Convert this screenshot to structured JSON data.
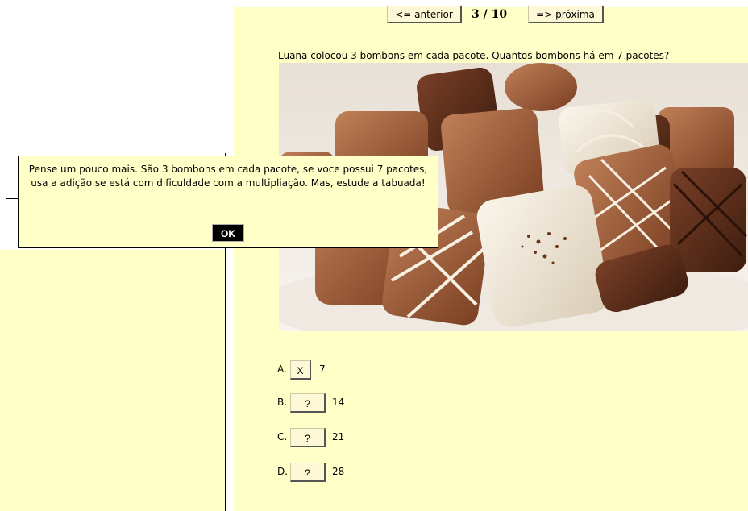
{
  "nav": {
    "prev_label": "<= anterior",
    "counter": "3 / 10",
    "next_label": "=> próxima"
  },
  "question": {
    "text": "Luana colocou 3 bombons em cada pacote. Quantos bombons há em 7 pacotes?",
    "image": "chocolate-bonbons-photo"
  },
  "options": [
    {
      "letter": "A.",
      "mark": "X",
      "value": "7"
    },
    {
      "letter": "B.",
      "mark": "?",
      "value": "14"
    },
    {
      "letter": "C.",
      "mark": "?",
      "value": "21"
    },
    {
      "letter": "D.",
      "mark": "?",
      "value": "28"
    }
  ],
  "dialog": {
    "message": "Pense um pouco mais. São 3 bombons em cada pacote, se voce possui 7 pacotes, usa a adição se está com dificuldade com a multipliação. Mas, estude a tabuada!",
    "ok_label": "OK"
  },
  "colors": {
    "panel_bg": "#ffffc8",
    "button_bg": "#fff8d6",
    "chocolate_milk": "#a0623a",
    "chocolate_dark": "#5a2e18",
    "chocolate_white": "#f3ead8"
  }
}
